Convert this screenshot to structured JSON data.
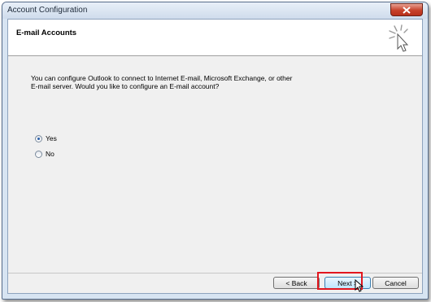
{
  "window": {
    "title": "Account Configuration"
  },
  "header": {
    "title": "E-mail Accounts",
    "icon": "wizard-sparkle-icon"
  },
  "main": {
    "description": "You can configure Outlook to connect to Internet E-mail, Microsoft Exchange, or other E-mail server. Would you like to configure an E-mail account?",
    "options": [
      {
        "label": "Yes",
        "checked": true
      },
      {
        "label": "No",
        "checked": false
      }
    ]
  },
  "footer": {
    "back_label": "< Back",
    "next_label": "Next >",
    "cancel_label": "Cancel"
  },
  "colors": {
    "highlight": "#e2161e",
    "close": "#c7412a"
  }
}
